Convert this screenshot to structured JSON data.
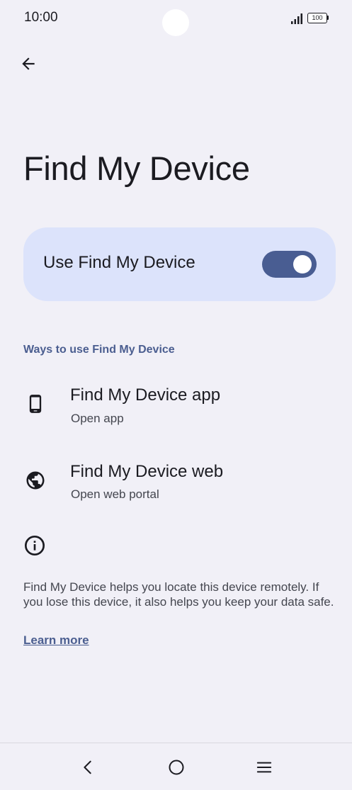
{
  "status_bar": {
    "time": "10:00",
    "battery": "100"
  },
  "header": {
    "back_icon": "arrow-back-icon"
  },
  "page": {
    "title": "Find My Device"
  },
  "main_toggle": {
    "label": "Use Find My Device",
    "enabled": true,
    "accent_color": "#495d92",
    "card_color": "#dce3fb"
  },
  "section": {
    "header": "Ways to use Find My Device",
    "items": [
      {
        "title": "Find My Device app",
        "subtitle": "Open app",
        "icon": "phone-icon"
      },
      {
        "title": "Find My Device web",
        "subtitle": "Open web portal",
        "icon": "globe-icon"
      }
    ]
  },
  "info": {
    "icon": "info-icon",
    "text": "Find My Device helps you locate this device remotely. If you lose this device, it also helps you keep your data safe.",
    "link": "Learn more"
  },
  "nav_bar": {
    "back": "nav-back-icon",
    "home": "nav-home-icon",
    "recents": "nav-recents-icon"
  }
}
